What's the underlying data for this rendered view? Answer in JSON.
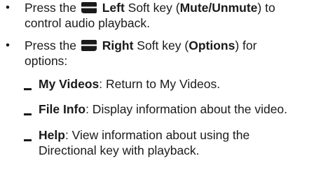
{
  "bullets": [
    {
      "press": "Press the",
      "icon": "left-softkey-icon",
      "key": "Left",
      "mid": "Soft key (",
      "action": "Mute/Unmute",
      "end": ") to",
      "line2": "control audio playback."
    },
    {
      "press": "Press the",
      "icon": "right-softkey-icon",
      "key": "Right",
      "mid": "Soft key (",
      "action": "Options",
      "end": ") for",
      "line2": "options:"
    }
  ],
  "options": [
    {
      "term": "My Videos",
      "desc": ": Return to My Videos."
    },
    {
      "term": "File Info",
      "desc": ": Display information about the video."
    },
    {
      "term": "Help",
      "desc": ": View information about using the",
      "line2": "Directional key with playback."
    }
  ]
}
